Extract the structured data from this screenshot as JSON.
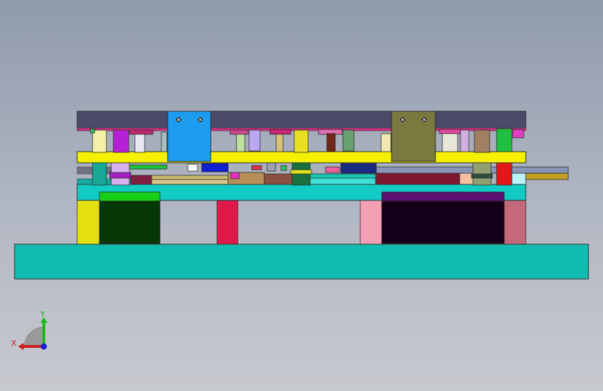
{
  "view": {
    "background_top": "#8f9aac",
    "background_bottom": "#c7c9cf",
    "outline_color": "#2a2a2a"
  },
  "triad": {
    "x_label": "X",
    "y_label": "Y",
    "x_color": "#d01818",
    "y_color": "#18b818",
    "z_color": "#1820d0"
  },
  "colors": {
    "base_plate": "#12bcb0",
    "lower_die_plate": "#12ccc4",
    "yellow_plate": "#f4f000",
    "top_plate": "#4a4a6a",
    "top_strip": "#d03080",
    "blue_block": "#1e9cf0",
    "olive_block": "#7a7a40",
    "green_block": "#063806",
    "green_block_top": "#18d018",
    "purple_block": "#140018",
    "purple_block_top": "#5a1070",
    "left_yellow_post": "#e6e010",
    "red_post": "#e0184a",
    "pink_post": "#f4a0b4",
    "right_pink_post": "#c4687a",
    "strip_gray": "#8894b8",
    "strip_gold": "#c4a020",
    "dark_red": "#801830"
  }
}
